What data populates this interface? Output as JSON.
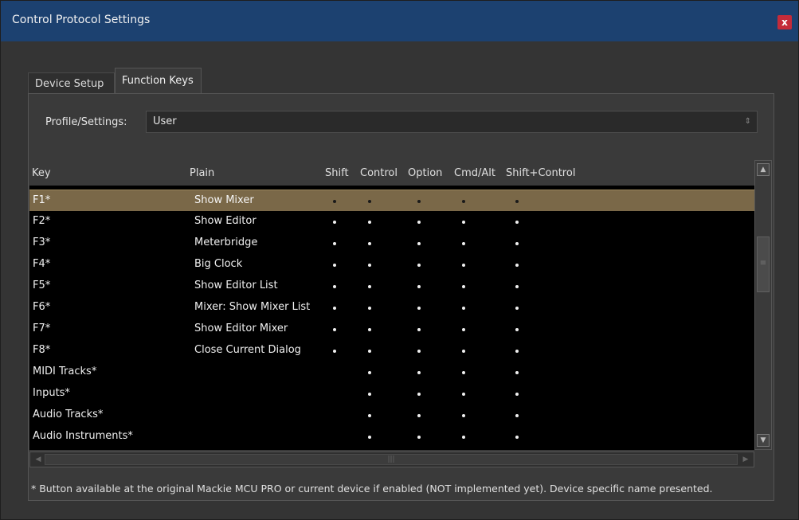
{
  "window": {
    "title": "Control Protocol Settings",
    "close_label": "x"
  },
  "tabs": [
    {
      "label": "Device Setup",
      "active": false
    },
    {
      "label": "Function Keys",
      "active": true
    }
  ],
  "profile": {
    "label": "Profile/Settings:",
    "value": "User",
    "arrow_icon": "updown-arrow-icon"
  },
  "table": {
    "columns": [
      "Key",
      "Plain",
      "Shift",
      "Control",
      "Option",
      "Cmd/Alt",
      "Shift+Control"
    ],
    "rows": [
      {
        "key": "F1*",
        "plain": "Show Mixer",
        "marks": [
          true,
          true,
          true,
          true,
          true
        ],
        "selected": true
      },
      {
        "key": "F2*",
        "plain": "Show Editor",
        "marks": [
          true,
          true,
          true,
          true,
          true
        ],
        "selected": false
      },
      {
        "key": "F3*",
        "plain": "Meterbridge",
        "marks": [
          true,
          true,
          true,
          true,
          true
        ],
        "selected": false
      },
      {
        "key": "F4*",
        "plain": "Big Clock",
        "marks": [
          true,
          true,
          true,
          true,
          true
        ],
        "selected": false
      },
      {
        "key": "F5*",
        "plain": "Show Editor List",
        "marks": [
          true,
          true,
          true,
          true,
          true
        ],
        "selected": false
      },
      {
        "key": "F6*",
        "plain": "Mixer: Show Mixer List",
        "marks": [
          true,
          true,
          true,
          true,
          true
        ],
        "selected": false
      },
      {
        "key": "F7*",
        "plain": "Show Editor Mixer",
        "marks": [
          true,
          true,
          true,
          true,
          true
        ],
        "selected": false
      },
      {
        "key": "F8*",
        "plain": "Close Current Dialog",
        "marks": [
          true,
          true,
          true,
          true,
          true
        ],
        "selected": false
      },
      {
        "key": "MIDI Tracks*",
        "plain": "",
        "marks": [
          false,
          true,
          true,
          true,
          true
        ],
        "selected": false
      },
      {
        "key": "Inputs*",
        "plain": "",
        "marks": [
          false,
          true,
          true,
          true,
          true
        ],
        "selected": false
      },
      {
        "key": "Audio Tracks*",
        "plain": "",
        "marks": [
          false,
          true,
          true,
          true,
          true
        ],
        "selected": false
      },
      {
        "key": "Audio Instruments*",
        "plain": "",
        "marks": [
          false,
          true,
          true,
          true,
          true
        ],
        "selected": false
      }
    ]
  },
  "footnote": "* Button available at the original Mackie MCU PRO or current device if enabled (NOT implemented yet). Device specific name presented.",
  "colors": {
    "titlebar": "#1c4170",
    "close": "#c42b3a",
    "selected_row": "#7a6848",
    "table_bg": "#000000"
  }
}
